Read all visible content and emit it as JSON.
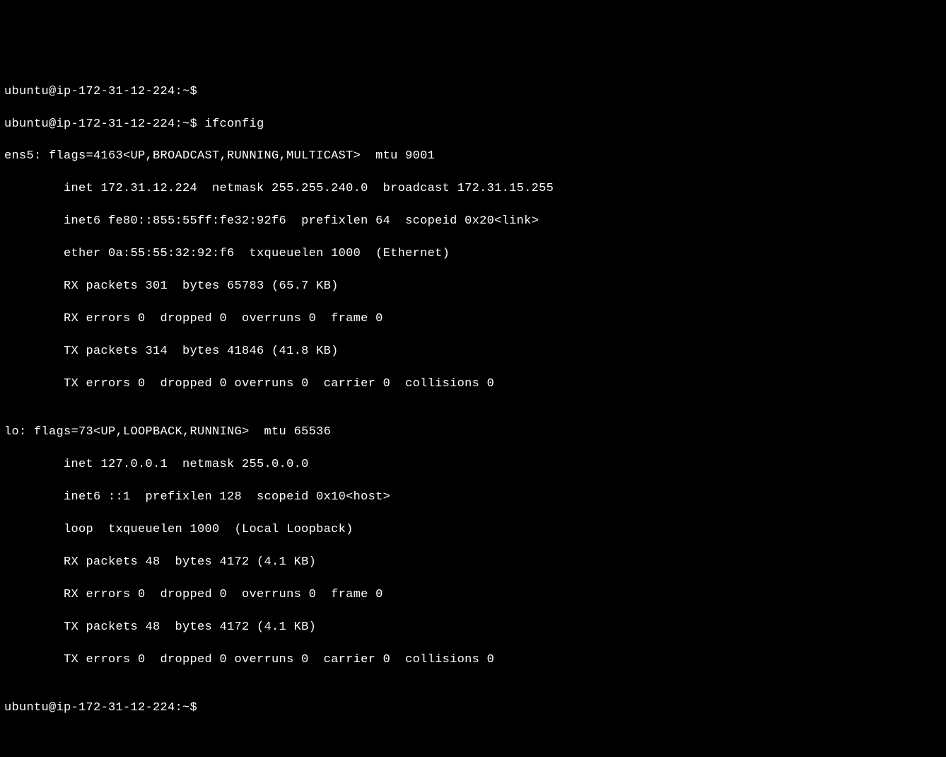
{
  "prompt": "ubuntu@ip-172-31-12-224:~$",
  "command": "ifconfig",
  "interfaces": [
    {
      "name": "ens5",
      "flags_num": "4163",
      "flags_list": "UP,BROADCAST,RUNNING,MULTICAST",
      "mtu": "9001",
      "inet": "172.31.12.224",
      "netmask": "255.255.240.0",
      "broadcast": "172.31.15.255",
      "inet6": "fe80::855:55ff:fe32:92f6",
      "prefixlen": "64",
      "scopeid": "0x20",
      "scopeid_suffix": "<link>",
      "ether": "0a:55:55:32:92:f6",
      "txqueuelen": "1000",
      "type": "Ethernet",
      "rx_packets": "301",
      "rx_bytes": "65783",
      "rx_bytes_human": "65.7 KB",
      "rx_errors": "0",
      "rx_dropped": "0",
      "rx_overruns": "0",
      "rx_frame": "0",
      "tx_packets": "314",
      "tx_bytes": "41846",
      "tx_bytes_human": "41.8 KB",
      "tx_errors": "0",
      "tx_dropped": "0",
      "tx_overruns": "0",
      "tx_carrier": "0",
      "tx_collisions": "0"
    },
    {
      "name": "lo",
      "flags_num": "73",
      "flags_list": "UP,LOOPBACK,RUNNING",
      "mtu": "65536",
      "inet": "127.0.0.1",
      "netmask": "255.0.0.0",
      "inet6": "::1",
      "prefixlen": "128",
      "scopeid": "0x10",
      "scopeid_suffix": "<host>",
      "loop": "loop",
      "txqueuelen": "1000",
      "type": "Local Loopback",
      "rx_packets": "48",
      "rx_bytes": "4172",
      "rx_bytes_human": "4.1 KB",
      "rx_errors": "0",
      "rx_dropped": "0",
      "rx_overruns": "0",
      "rx_frame": "0",
      "tx_packets": "48",
      "tx_bytes": "4172",
      "tx_bytes_human": "4.1 KB",
      "tx_errors": "0",
      "tx_dropped": "0",
      "tx_overruns": "0",
      "tx_carrier": "0",
      "tx_collisions": "0"
    }
  ],
  "lines": {
    "l1": "ubuntu@ip-172-31-12-224:~$",
    "l2": "ubuntu@ip-172-31-12-224:~$ ifconfig",
    "l3": "ens5: flags=4163<UP,BROADCAST,RUNNING,MULTICAST>  mtu 9001",
    "l4": "        inet 172.31.12.224  netmask 255.255.240.0  broadcast 172.31.15.255",
    "l5": "        inet6 fe80::855:55ff:fe32:92f6  prefixlen 64  scopeid 0x20<link>",
    "l6": "        ether 0a:55:55:32:92:f6  txqueuelen 1000  (Ethernet)",
    "l7": "        RX packets 301  bytes 65783 (65.7 KB)",
    "l8": "        RX errors 0  dropped 0  overruns 0  frame 0",
    "l9": "        TX packets 314  bytes 41846 (41.8 KB)",
    "l10": "        TX errors 0  dropped 0 overruns 0  carrier 0  collisions 0",
    "l11": "",
    "l12": "lo: flags=73<UP,LOOPBACK,RUNNING>  mtu 65536",
    "l13": "        inet 127.0.0.1  netmask 255.0.0.0",
    "l14": "        inet6 ::1  prefixlen 128  scopeid 0x10<host>",
    "l15": "        loop  txqueuelen 1000  (Local Loopback)",
    "l16": "        RX packets 48  bytes 4172 (4.1 KB)",
    "l17": "        RX errors 0  dropped 0  overruns 0  frame 0",
    "l18": "        TX packets 48  bytes 4172 (4.1 KB)",
    "l19": "        TX errors 0  dropped 0 overruns 0  carrier 0  collisions 0",
    "l20": "",
    "l21": "ubuntu@ip-172-31-12-224:~$"
  }
}
